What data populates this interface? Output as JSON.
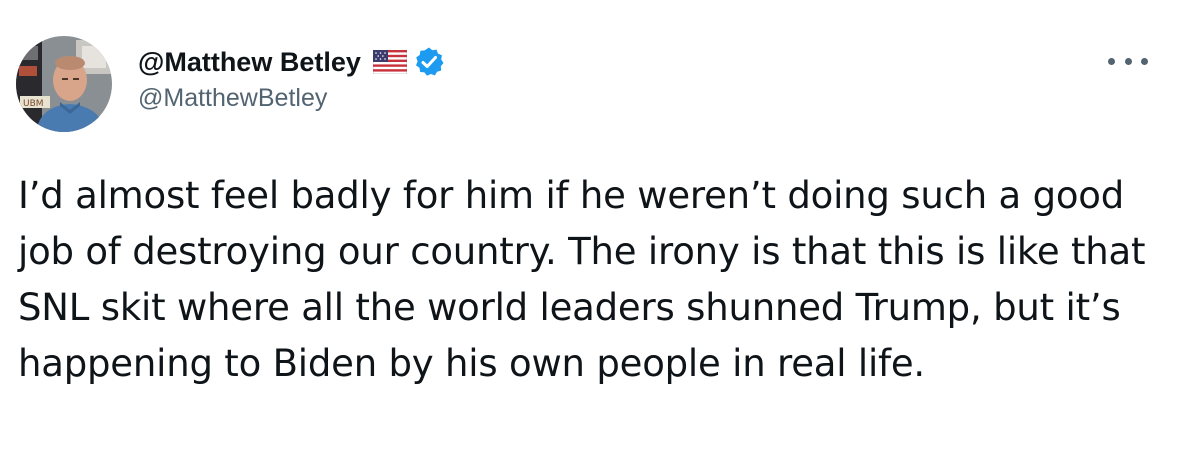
{
  "tweet": {
    "display_name": "@Matthew Betley",
    "handle": "@MatthewBetley",
    "text": "I’d almost feel badly for him if he weren’t doing such a good job of destroying our country. The irony is that this is like that SNL skit where all the world leaders shunned Trump, but it’s happening to Biden by his own people in real life.",
    "icons": {
      "flag": "us-flag-icon",
      "verified": "verified-badge-icon",
      "more": "more-options-icon"
    },
    "colors": {
      "verified_blue": "#1d9bf0",
      "secondary_text": "#536471",
      "primary_text": "#0f1419"
    }
  },
  "avatar": {
    "sign_text": "UBM"
  }
}
